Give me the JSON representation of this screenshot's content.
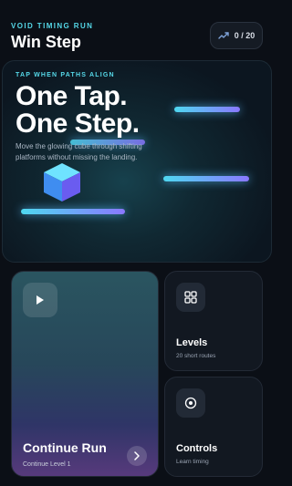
{
  "header": {
    "eyebrow": "VOID TIMING RUN",
    "title": "Win Step",
    "progress": {
      "text": "0 / 20",
      "icon": "trend-up-icon"
    }
  },
  "hero": {
    "eyebrow": "TAP WHEN PATHS ALIGN",
    "title_line1": "One Tap.",
    "title_line2": "One Step.",
    "description": "Move the glowing cube through shifting platforms without missing the landing."
  },
  "cards": {
    "continue": {
      "title": "Continue Run",
      "subtitle": "Continue Level 1",
      "icon": "play-icon",
      "arrow_icon": "chevron-right-icon"
    },
    "levels": {
      "title": "Levels",
      "subtitle": "20 short routes",
      "icon": "grid-icon"
    },
    "controls": {
      "title": "Controls",
      "subtitle": "Learn timing",
      "icon": "target-icon"
    }
  },
  "colors": {
    "accent": "#55d8e8",
    "platform_start": "#4fd8f0",
    "platform_end": "#8a78ff",
    "background": "#0b0f16"
  }
}
